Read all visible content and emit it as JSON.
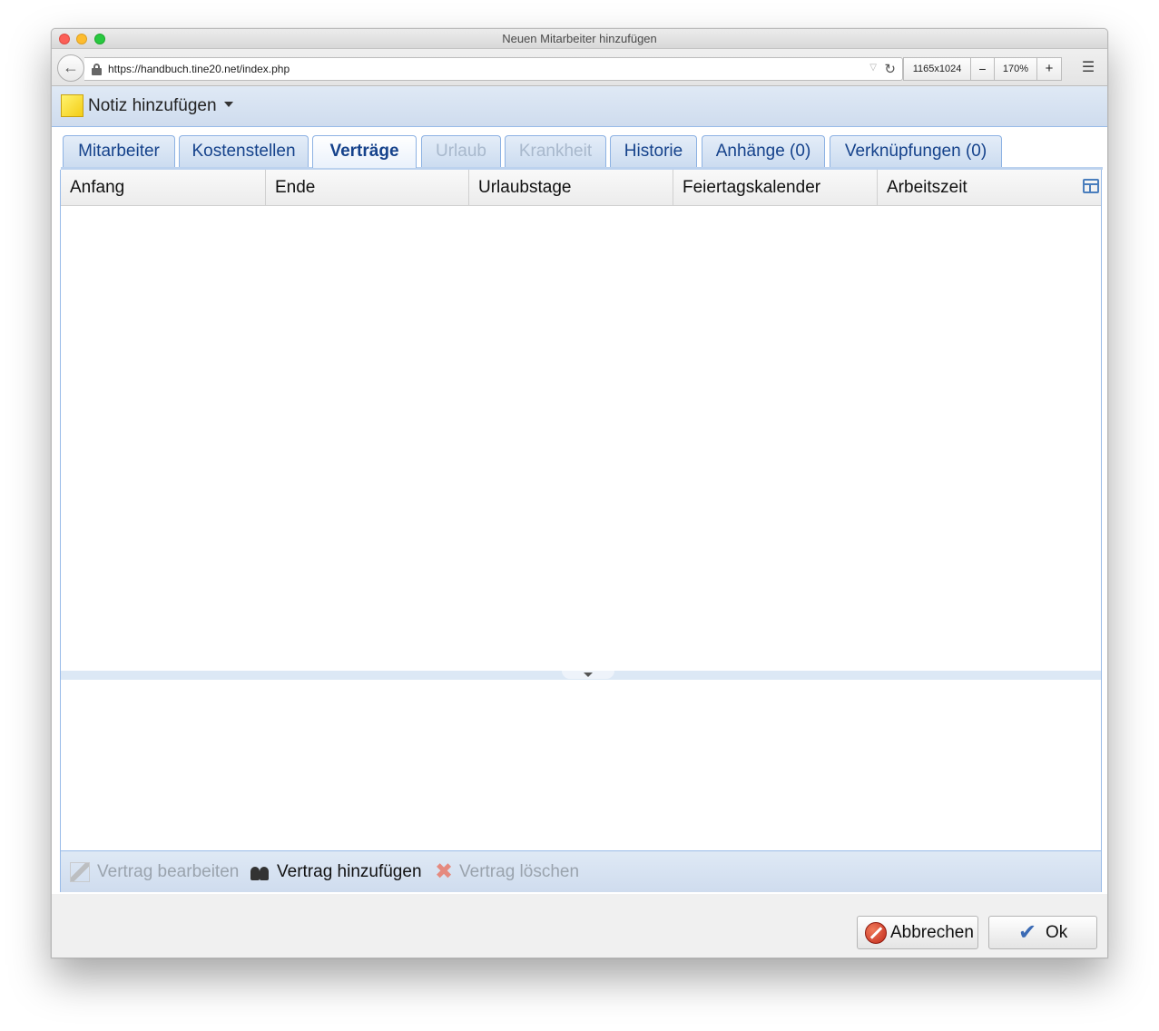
{
  "window": {
    "title": "Neuen Mitarbeiter hinzufügen"
  },
  "browser": {
    "url": "https://handbuch.tine20.net/index.php",
    "size": "1165x1024",
    "zoom_out": "−",
    "zoom_level": "170%",
    "zoom_in": "+"
  },
  "toolbar": {
    "note_label": "Notiz hinzufügen"
  },
  "tabs": [
    {
      "label": "Mitarbeiter",
      "state": "normal"
    },
    {
      "label": "Kostenstellen",
      "state": "normal"
    },
    {
      "label": "Verträge",
      "state": "active"
    },
    {
      "label": "Urlaub",
      "state": "disabled"
    },
    {
      "label": "Krankheit",
      "state": "disabled"
    },
    {
      "label": "Historie",
      "state": "normal"
    },
    {
      "label": "Anhänge (0)",
      "state": "normal"
    },
    {
      "label": "Verknüpfungen (0)",
      "state": "normal"
    }
  ],
  "grid": {
    "columns": [
      "Anfang",
      "Ende",
      "Urlaubstage",
      "Feiertagskalender",
      "Arbeitszeit"
    ]
  },
  "grid_toolbar": {
    "edit_label": "Vertrag bearbeiten",
    "add_label": "Vertrag hinzufügen",
    "delete_label": "Vertrag löschen"
  },
  "footer": {
    "cancel_label": "Abbrechen",
    "ok_label": "Ok"
  },
  "colors": {
    "accent": "#15428b",
    "toolbar_bg": "#dfe9f5",
    "border": "#99bbe8"
  }
}
